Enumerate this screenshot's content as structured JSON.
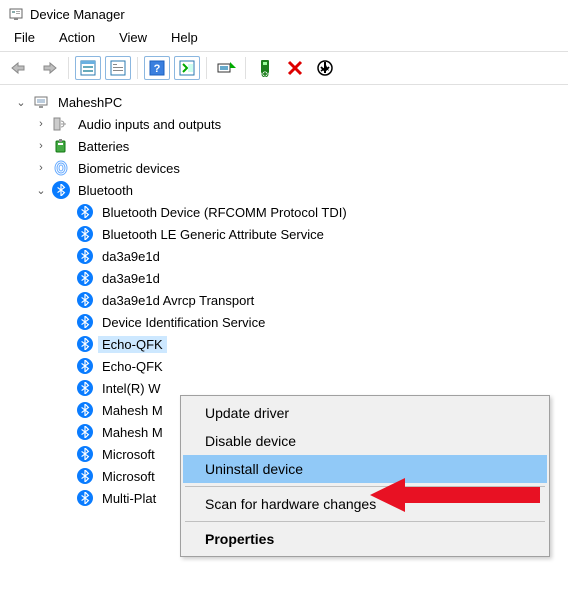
{
  "window": {
    "title": "Device Manager"
  },
  "menubar": {
    "file": "File",
    "action": "Action",
    "view": "View",
    "help": "Help"
  },
  "tree": {
    "root": {
      "name": "MaheshPC"
    },
    "categories": [
      {
        "label": "Audio inputs and outputs",
        "expanded": false
      },
      {
        "label": "Batteries",
        "expanded": false
      },
      {
        "label": "Biometric devices",
        "expanded": false
      },
      {
        "label": "Bluetooth",
        "expanded": true
      }
    ],
    "bluetooth_items": [
      "Bluetooth Device (RFCOMM Protocol TDI)",
      "Bluetooth LE Generic Attribute Service",
      "da3a9e1d",
      "da3a9e1d",
      "da3a9e1d Avrcp Transport",
      "Device Identification Service",
      "Echo-QFK",
      "Echo-QFK",
      "Intel(R) W",
      "Mahesh M",
      "Mahesh M",
      "Microsoft",
      "Microsoft",
      "Multi-Plat"
    ],
    "selected_index": 6
  },
  "contextmenu": {
    "update": "Update driver",
    "disable": "Disable device",
    "uninstall": "Uninstall device",
    "scan": "Scan for hardware changes",
    "properties": "Properties"
  }
}
